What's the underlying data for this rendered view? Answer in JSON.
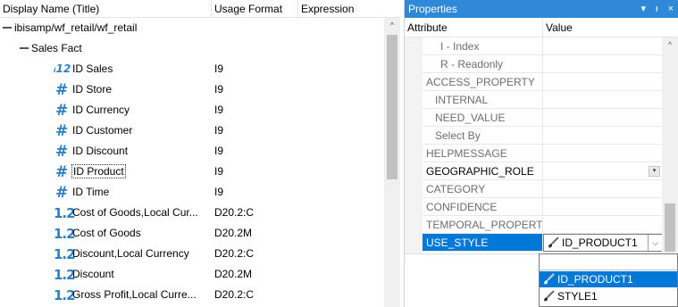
{
  "grid": {
    "headers": {
      "name": "Display Name (Title)",
      "format": "Usage Format",
      "expression": "Expression"
    },
    "root": "ibisamp/wf_retail/wf_retail",
    "segment": "Sales Fact",
    "rows": [
      {
        "icon": "id-icon",
        "glyph": "ꟷ12",
        "label": "ID Sales",
        "format": "I9"
      },
      {
        "icon": "hash-icon",
        "glyph": "#",
        "label": "ID Store",
        "format": "I9"
      },
      {
        "icon": "hash-icon",
        "glyph": "#",
        "label": "ID Currency",
        "format": "I9"
      },
      {
        "icon": "hash-icon",
        "glyph": "#",
        "label": "ID Customer",
        "format": "I9"
      },
      {
        "icon": "hash-icon",
        "glyph": "#",
        "label": "ID Discount",
        "format": "I9"
      },
      {
        "icon": "hash-icon",
        "glyph": "#",
        "label": "ID Product",
        "format": "I9"
      },
      {
        "icon": "hash-icon",
        "glyph": "#",
        "label": "ID Time",
        "format": "I9"
      },
      {
        "icon": "decimal-icon",
        "glyph": "1.2",
        "label": "Cost of Goods,Local Cur...",
        "format": "D20.2:C"
      },
      {
        "icon": "decimal-icon",
        "glyph": "1.2",
        "label": "Cost of Goods",
        "format": "D20.2M"
      },
      {
        "icon": "decimal-icon",
        "glyph": "1.2",
        "label": "Discount,Local Currency",
        "format": "D20.2:C"
      },
      {
        "icon": "decimal-icon",
        "glyph": "1.2",
        "label": "Discount",
        "format": "D20.2M"
      },
      {
        "icon": "decimal-icon",
        "glyph": "1.2",
        "label": "Gross Profit,Local Curre...",
        "format": "D20.2:C"
      }
    ],
    "scroll_up_glyph": "^"
  },
  "props": {
    "title": "Properties",
    "title_buttons": [
      "▾",
      "ᵻ",
      "×"
    ],
    "headers": {
      "attribute": "Attribute",
      "value": "Value"
    },
    "rows": [
      {
        "label": "I - Index",
        "indent": true
      },
      {
        "label": "R - Readonly",
        "indent": true
      },
      {
        "label": "ACCESS_PROPERTY",
        "indent": false
      },
      {
        "label": "INTERNAL",
        "indent": true
      },
      {
        "label": "NEED_VALUE",
        "indent": true
      },
      {
        "label": "Select By",
        "indent": true
      },
      {
        "label": "HELPMESSAGE",
        "indent": false
      },
      {
        "label": "GEOGRAPHIC_ROLE",
        "indent": false
      },
      {
        "label": "CATEGORY",
        "indent": false
      },
      {
        "label": "CONFIDENCE",
        "indent": false
      },
      {
        "label": "TEMPORAL_PROPERTY",
        "indent": false
      },
      {
        "label": "USE_STYLE",
        "indent": false
      }
    ],
    "use_style_value": "ID_PRODUCT1",
    "dropdown_options": [
      "ID_PRODUCT1",
      "STYLE1"
    ],
    "scroll_up_glyph": "^",
    "dropdown_arrow": "▾",
    "combo_arrow": "⌵"
  },
  "colors": {
    "accent": "#2f88d8",
    "selection": "#0078d7",
    "icon_blue": "#2c80c5"
  }
}
